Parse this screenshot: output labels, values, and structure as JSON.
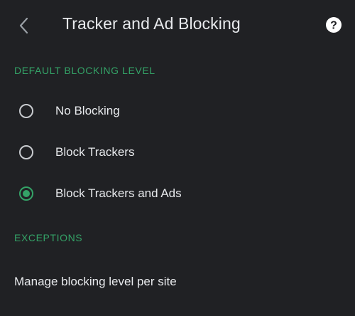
{
  "header": {
    "title": "Tracker and Ad Blocking",
    "back_icon": "chevron-left-icon",
    "help_icon": "help-circle-icon"
  },
  "sections": {
    "default_level": {
      "title": "DEFAULT BLOCKING LEVEL",
      "options": [
        {
          "label": "No Blocking",
          "selected": false
        },
        {
          "label": "Block Trackers",
          "selected": false
        },
        {
          "label": "Block Trackers and Ads",
          "selected": true
        }
      ]
    },
    "exceptions": {
      "title": "EXCEPTIONS",
      "items": [
        {
          "label": "Manage blocking level per site"
        }
      ]
    }
  },
  "colors": {
    "background": "#202124",
    "accent": "#34a367",
    "text": "#e8eaed",
    "radio_unchecked": "#c8cbcf"
  }
}
